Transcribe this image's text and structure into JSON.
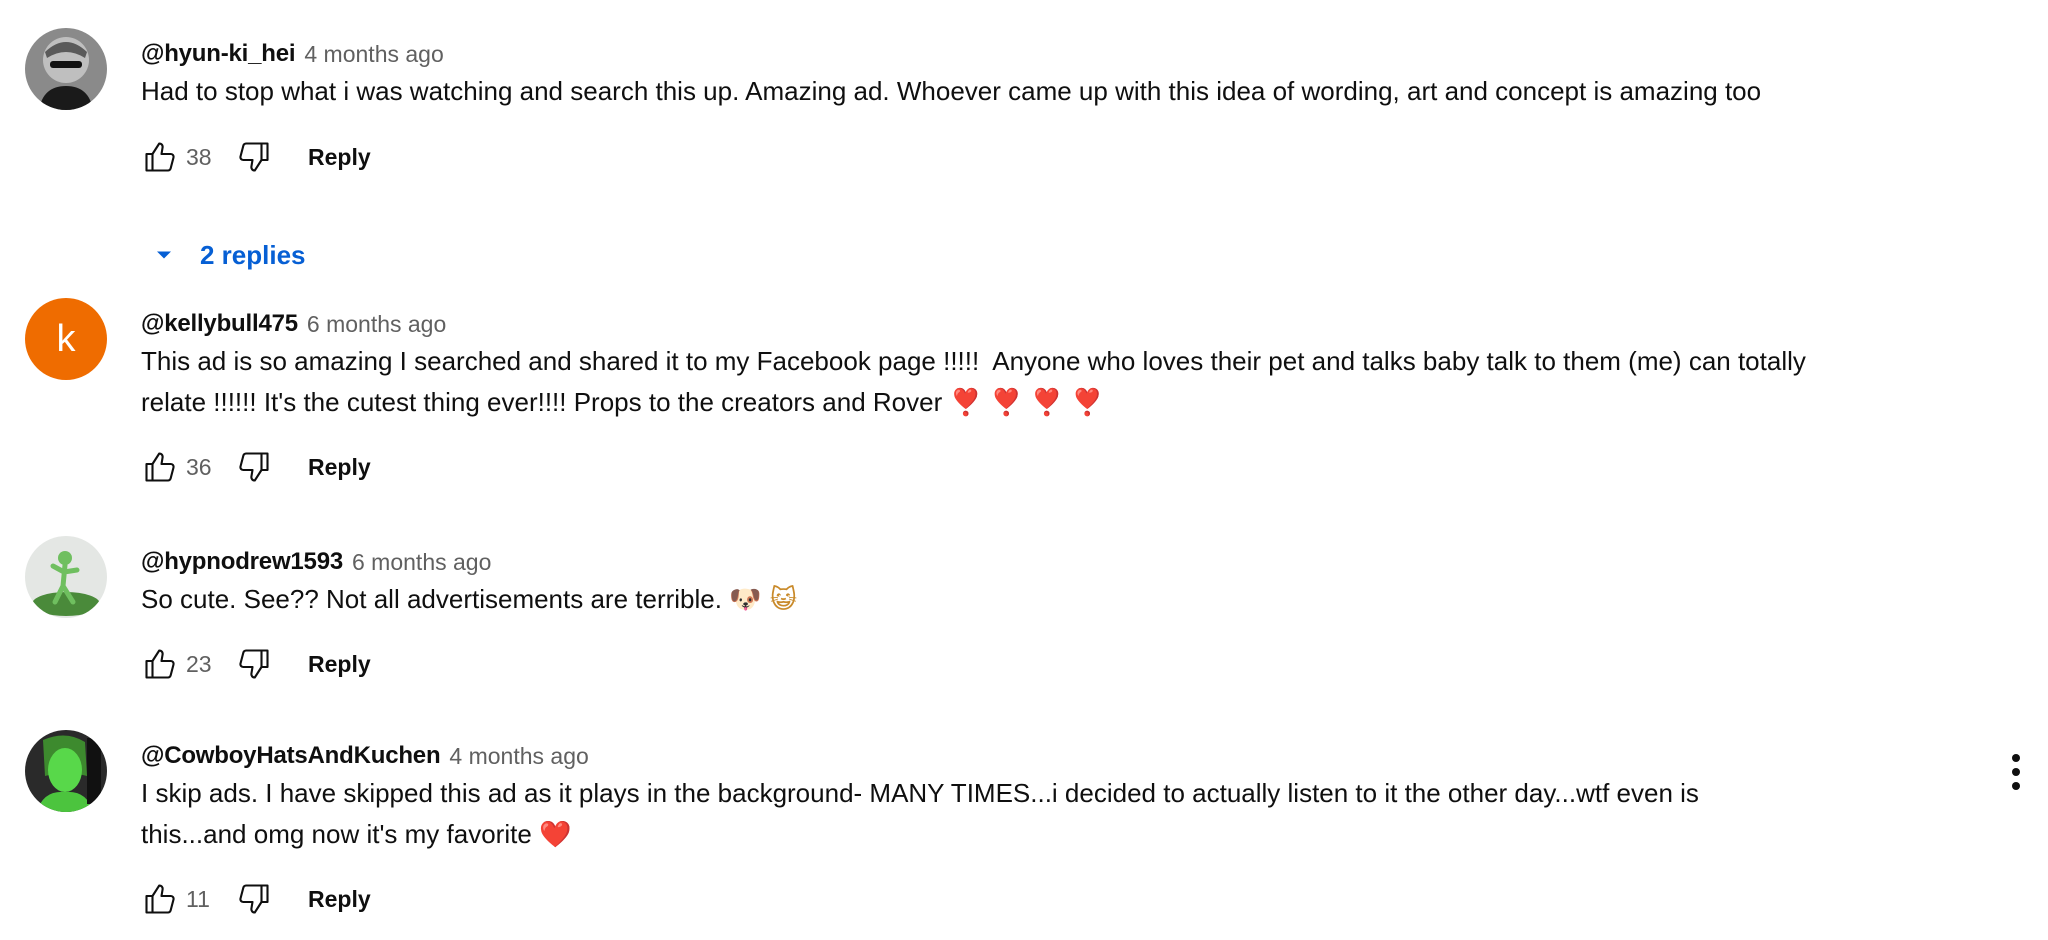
{
  "comments": [
    {
      "author": "@hyun-ki_hei",
      "time": "4 months ago",
      "text": "Had to stop what i was watching and search this up. Amazing ad. Whoever came up with this idea of wording, art and concept is amazing too",
      "likes": "38",
      "reply_label": "Reply",
      "avatar_icon": "grey-cartoon-person-avatar",
      "replies_label": "2 replies"
    },
    {
      "author": "@kellybull475",
      "time": "6 months ago",
      "text_line1": "This ad is so amazing I searched and shared it to my Facebook page !!!!!  Anyone who loves their pet and talks baby talk to them (me) can totally",
      "text_line2": "relate !!!!!! It's the cutest thing ever!!!! Props to the creators and Rover",
      "emoji": "❣️ ❣️ ❣️ ❣️",
      "likes": "36",
      "reply_label": "Reply",
      "avatar_letter": "k",
      "avatar_color": "#ef6c00"
    },
    {
      "author": "@hypnodrew1593",
      "time": "6 months ago",
      "text": "So cute. See?? Not all advertisements are terrible.",
      "emoji": "🐶 😺",
      "likes": "23",
      "reply_label": "Reply",
      "avatar_icon": "green-figure-avatar"
    },
    {
      "author": "@CowboyHatsAndKuchen",
      "time": "4 months ago",
      "text_line1": "I skip ads. I have skipped this ad as it plays in the background- MANY TIMES...i decided to actually listen to it the other day...wtf even is",
      "text_line2": "this...and omg now it's my favorite",
      "emoji": "❤️",
      "likes": "11",
      "reply_label": "Reply",
      "avatar_icon": "green-face-photo-avatar"
    }
  ],
  "icons": {
    "like": "thumbs-up-icon",
    "dislike": "thumbs-down-icon",
    "expand": "caret-down-icon",
    "menu": "more-vertical-icon"
  },
  "colors": {
    "link_blue": "#065fd4",
    "secondary_text": "#606060"
  }
}
